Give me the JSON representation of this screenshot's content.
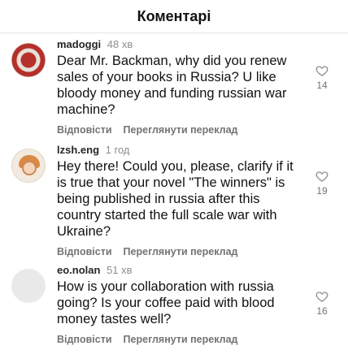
{
  "header": {
    "title": "Коментарі"
  },
  "comments": [
    {
      "username": "madoggi",
      "time": "48 хв",
      "text": "Dear Mr. Backman, why did you renew sales of your books in Russia? U like bloody money and funding russian war machine?",
      "reply": "Відповісти",
      "translate": "Переглянути переклад",
      "likes": "14"
    },
    {
      "username": "lzsh.eng",
      "time": "1 год",
      "text": "Hey there! Could you, please, clarify if it is true that your novel \"The winners\" is being published in russia after this country started the full scale war with Ukraine?",
      "reply": "Відповісти",
      "translate": "Переглянути переклад",
      "likes": "19"
    },
    {
      "username": "eo.nolan",
      "time": "51 хв",
      "text": "How is your collaboration with russia going? Is your coffee paid with blood money tastes well?",
      "reply": "Відповісти",
      "translate": "Переглянути переклад",
      "likes": "16"
    }
  ],
  "icons": {
    "avatar": "user-avatar",
    "like": "heart-icon"
  },
  "colors": {
    "text": "#262626",
    "secondary": "#737373",
    "muted": "#8e8e8e"
  }
}
